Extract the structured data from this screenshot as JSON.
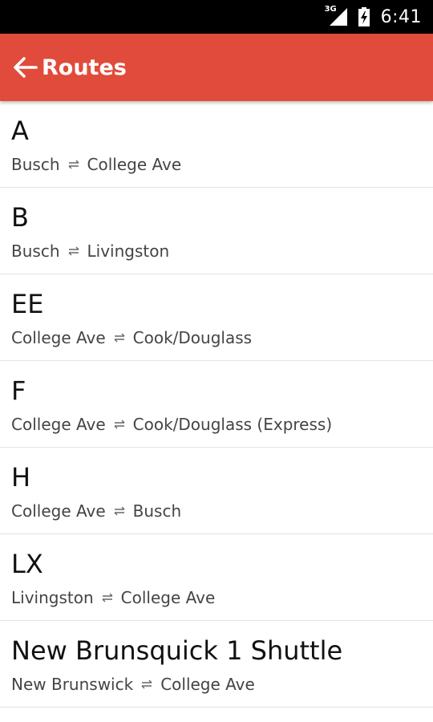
{
  "status_bar": {
    "network": "3G",
    "time": "6:41"
  },
  "app_bar": {
    "title": "Routes",
    "back_icon": "arrow-left-icon",
    "background": "#e14b3b"
  },
  "routes": [
    {
      "name": "A",
      "from": "Busch",
      "to": "College Ave"
    },
    {
      "name": "B",
      "from": "Busch",
      "to": "Livingston"
    },
    {
      "name": "EE",
      "from": "College Ave",
      "to": "Cook/Douglass"
    },
    {
      "name": "F",
      "from": "College Ave",
      "to": "Cook/Douglass (Express)"
    },
    {
      "name": "H",
      "from": "College Ave",
      "to": "Busch"
    },
    {
      "name": "LX",
      "from": "Livingston",
      "to": "College Ave"
    },
    {
      "name": "New Brunsquick 1 Shuttle",
      "from": "New Brunswick",
      "to": "College Ave"
    }
  ],
  "route_separator_icon": "swap-arrows-icon"
}
